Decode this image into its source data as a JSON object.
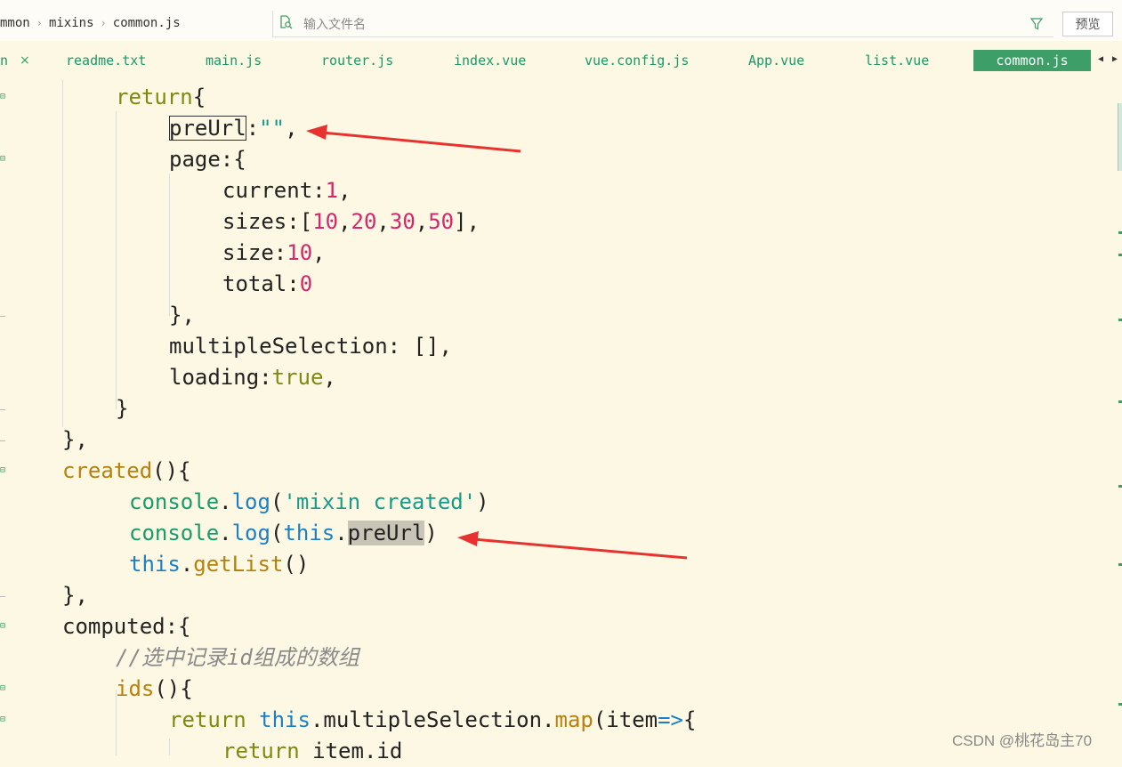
{
  "breadcrumb": {
    "parts": [
      "mmon",
      "mixins",
      "common.js"
    ]
  },
  "search": {
    "placeholder": "输入文件名"
  },
  "toolbar": {
    "preview_label": "预览"
  },
  "tabs": {
    "partial_label": "n",
    "items": [
      {
        "label": "readme.txt"
      },
      {
        "label": "main.js"
      },
      {
        "label": "router.js"
      },
      {
        "label": "index.vue"
      },
      {
        "label": "vue.config.js"
      },
      {
        "label": "App.vue"
      },
      {
        "label": "list.vue"
      },
      {
        "label": "common.js",
        "active": true
      }
    ]
  },
  "code": {
    "l1": [
      "return",
      "{"
    ],
    "l2": [
      "preUrl",
      ":",
      "\"\"",
      ","
    ],
    "l3": [
      "page",
      ":{"
    ],
    "l4": [
      "current",
      ":",
      "1",
      ","
    ],
    "l5": [
      "sizes",
      ":[",
      "10",
      ",",
      "20",
      ",",
      "30",
      ",",
      "50",
      "],"
    ],
    "l6": [
      "size",
      ":",
      "10",
      ","
    ],
    "l7": [
      "total",
      ":",
      "0"
    ],
    "l8": [
      "},"
    ],
    "l9": [
      "multipleSelection",
      ": [],"
    ],
    "l10": [
      "loading",
      ":",
      "true",
      ","
    ],
    "l11": [
      "}"
    ],
    "l12": [
      "},"
    ],
    "l13": [
      "created",
      "(){"
    ],
    "l14": [
      "console",
      ".",
      "log",
      "(",
      "'mixin created'",
      ")"
    ],
    "l15": [
      "console",
      ".",
      "log",
      "(",
      "this",
      ".",
      "preUrl",
      ")"
    ],
    "l16": [
      "this",
      ".",
      "getList",
      "()"
    ],
    "l17": [
      "},"
    ],
    "l18": [
      "computed",
      ":{"
    ],
    "l19": [
      "//选中记录id组成的数组"
    ],
    "l20": [
      "ids",
      "(){"
    ],
    "l21": [
      "return",
      " ",
      "this",
      ".multipleSelection.",
      "map",
      "(item",
      "=>",
      "{"
    ],
    "l22": [
      "return",
      " item.id"
    ]
  },
  "colors": {
    "accent": "#3d9f67",
    "arrow": "#e8322f",
    "background": "#fdf8e3"
  },
  "watermark": "CSDN @桃花岛主70"
}
